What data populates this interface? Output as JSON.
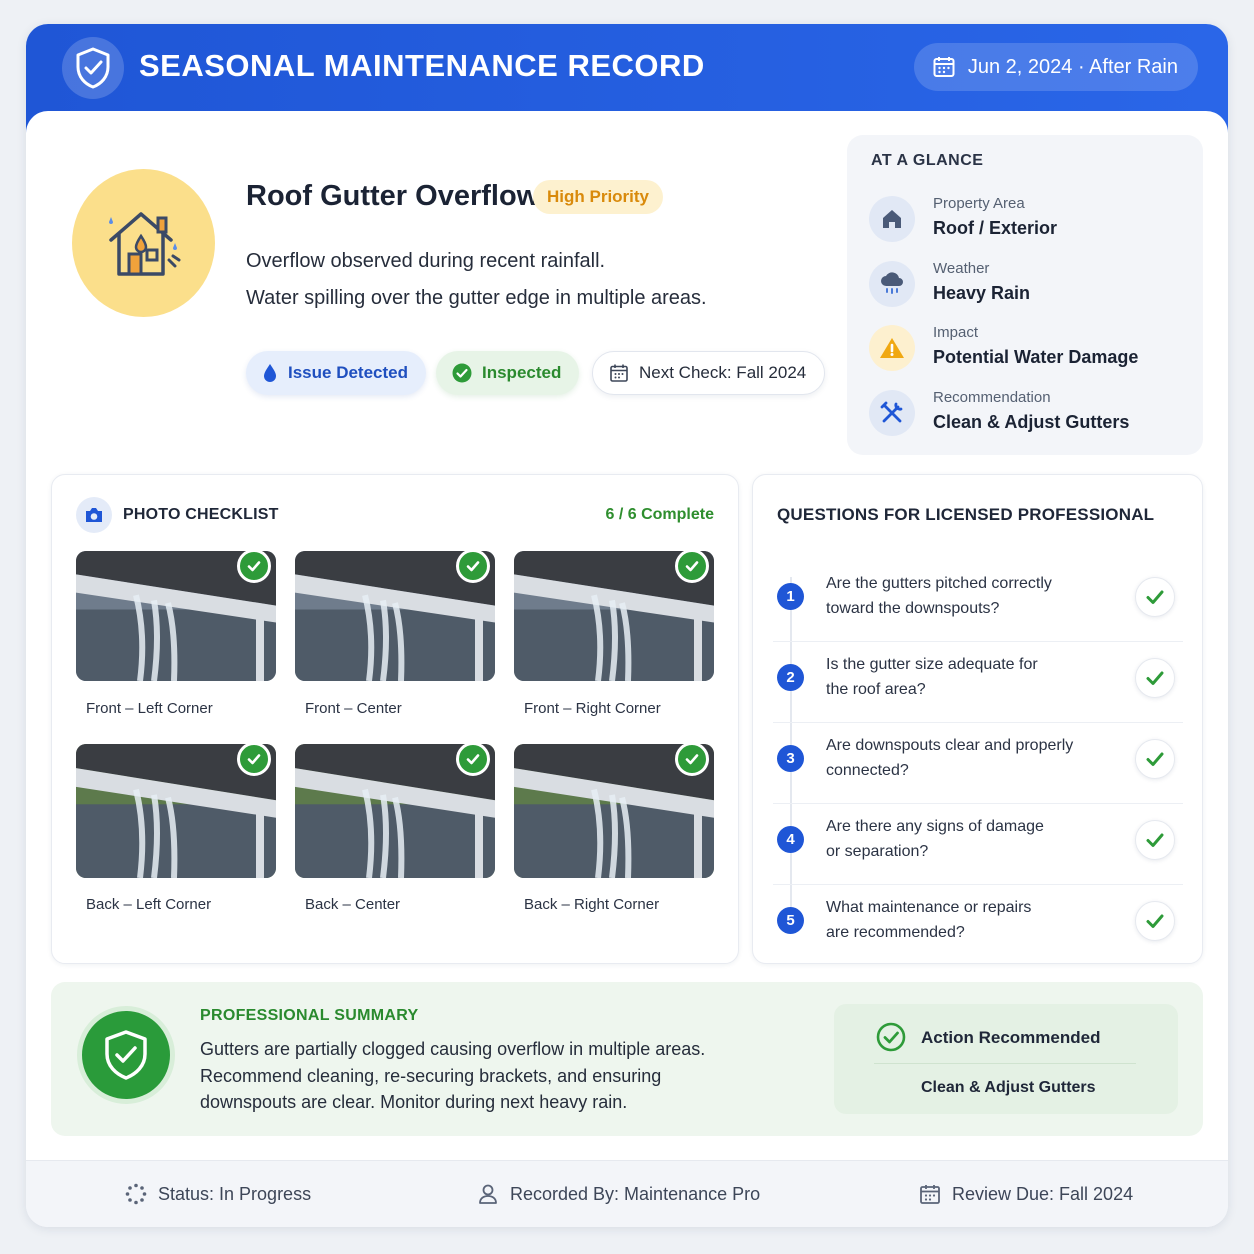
{
  "header": {
    "title": "SEASONAL MAINTENANCE RECORD",
    "date": "Jun 2, 2024 · After Rain",
    "brand_color": "#1f56d6"
  },
  "issue": {
    "title": "Roof Gutter Overflow",
    "priority": "High Priority",
    "description_line1": "Overflow observed during recent rainfall.",
    "description_line2": "Water spilling over the gutter edge in multiple areas.",
    "tags": {
      "issue": "Issue Detected",
      "inspected": "Inspected",
      "next_check": "Next Check: Fall 2024"
    }
  },
  "glance": {
    "title": "AT A GLANCE",
    "items": [
      {
        "label": "Property Area",
        "value": "Roof / Exterior",
        "icon": "house-icon"
      },
      {
        "label": "Weather",
        "value": "Heavy Rain",
        "icon": "rain-cloud-icon"
      },
      {
        "label": "Impact",
        "value": "Potential Water Damage",
        "icon": "warning-icon"
      },
      {
        "label": "Recommendation",
        "value": "Clean & Adjust Gutters",
        "icon": "tools-icon"
      }
    ]
  },
  "photos": {
    "title": "PHOTO CHECKLIST",
    "progress": "6 / 6 Complete",
    "items": [
      {
        "caption": "Front – Left Corner",
        "checked": true
      },
      {
        "caption": "Front – Center",
        "checked": true
      },
      {
        "caption": "Front – Right Corner",
        "checked": true
      },
      {
        "caption": "Back – Left Corner",
        "checked": true
      },
      {
        "caption": "Back – Center",
        "checked": true
      },
      {
        "caption": "Back – Right Corner",
        "checked": true
      }
    ]
  },
  "questions": {
    "title": "QUESTIONS FOR LICENSED PROFESSIONAL",
    "items": [
      {
        "num": "1",
        "line1": "Are the gutters pitched correctly",
        "line2": "toward the downspouts?",
        "checked": true
      },
      {
        "num": "2",
        "line1": "Is the gutter size adequate for",
        "line2": "the roof area?",
        "checked": true
      },
      {
        "num": "3",
        "line1": "Are downspouts clear and properly",
        "line2": "connected?",
        "checked": true
      },
      {
        "num": "4",
        "line1": "Are there any signs of damage",
        "line2": "or separation?",
        "checked": true
      },
      {
        "num": "5",
        "line1": "What maintenance or repairs",
        "line2": "are recommended?",
        "checked": true
      }
    ]
  },
  "summary": {
    "title": "PROFESSIONAL SUMMARY",
    "line1": "Gutters are partially clogged causing overflow in multiple areas.",
    "line2": "Recommend cleaning, re-securing brackets, and ensuring",
    "line3": "downspouts are clear. Monitor during next heavy rain.",
    "action_title": "Action Recommended",
    "action_value": "Clean & Adjust Gutters",
    "accent_color": "#2a9b3a"
  },
  "footer": {
    "status": "Status: In Progress",
    "recorded_by": "Recorded By: Maintenance Pro",
    "review_due": "Review Due: Fall 2024"
  }
}
